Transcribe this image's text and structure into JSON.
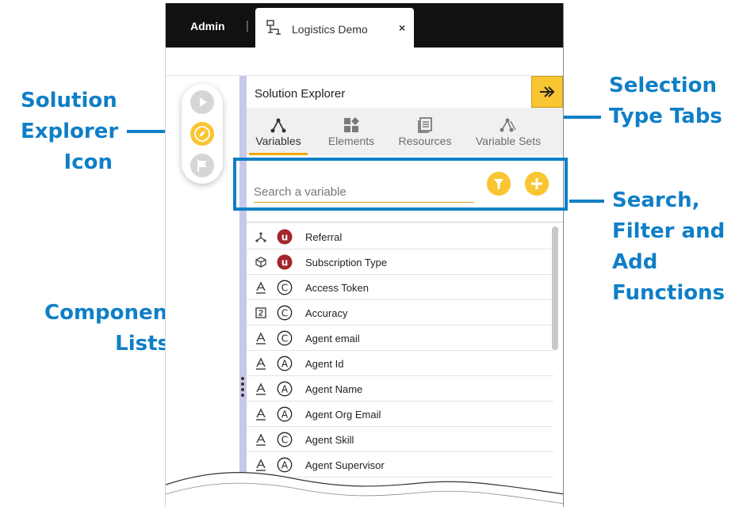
{
  "annotations": {
    "solution_explorer_icon": [
      "Solution",
      "Explorer",
      "Icon"
    ],
    "selection_type_tabs": [
      "Selection",
      "Type Tabs"
    ],
    "search_filter_add": [
      "Search,",
      "Filter and",
      "Add",
      "Functions"
    ],
    "component_lists": [
      "Component",
      "Lists"
    ]
  },
  "header": {
    "admin_label": "Admin",
    "separator": "|",
    "tab": {
      "label": "Logistics Demo",
      "close": "×",
      "icon": "workflow-icon"
    }
  },
  "rail": {
    "items": [
      {
        "icon": "play-icon",
        "active": false
      },
      {
        "icon": "compass-icon",
        "active": true
      },
      {
        "icon": "flag-icon",
        "active": false
      }
    ]
  },
  "solution_explorer": {
    "title": "Solution Explorer",
    "collapse_icon": "double-chevron-right-icon",
    "tabs": [
      {
        "label": "Variables",
        "icon": "variables-icon",
        "active": true
      },
      {
        "label": "Elements",
        "icon": "elements-icon",
        "active": false
      },
      {
        "label": "Resources",
        "icon": "resources-icon",
        "active": false
      },
      {
        "label": "Variable Sets",
        "icon": "variable-sets-icon",
        "active": false
      }
    ],
    "search": {
      "placeholder": "Search a variable",
      "value": ""
    },
    "buttons": {
      "filter_icon": "filter-icon",
      "add_icon": "plus-icon"
    },
    "variables": [
      {
        "type": "branch",
        "scope": "U",
        "label": "Referral"
      },
      {
        "type": "cube",
        "scope": "U",
        "label": "Subscription Type"
      },
      {
        "type": "text",
        "scope": "C",
        "label": "Access Token"
      },
      {
        "type": "number",
        "scope": "C",
        "label": "Accuracy"
      },
      {
        "type": "text",
        "scope": "C",
        "label": "Agent email"
      },
      {
        "type": "text",
        "scope": "A",
        "label": "Agent Id"
      },
      {
        "type": "text",
        "scope": "A",
        "label": "Agent Name"
      },
      {
        "type": "text",
        "scope": "A",
        "label": "Agent Org Email"
      },
      {
        "type": "text",
        "scope": "C",
        "label": "Agent Skill"
      },
      {
        "type": "text",
        "scope": "A",
        "label": "Agent Supervisor"
      }
    ]
  },
  "colors": {
    "accent_blue": "#0f7fc6",
    "accent_yellow": "#f9c531",
    "user_scope_red": "#a3262b",
    "topbar": "#111111",
    "splitter": "#c8c8ea"
  }
}
